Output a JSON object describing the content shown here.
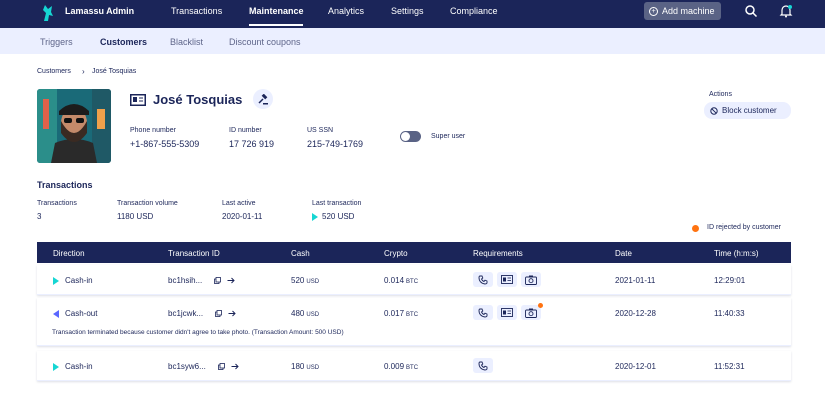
{
  "app": {
    "brand": "Lamassu Admin"
  },
  "nav": {
    "items": [
      {
        "label": "Transactions"
      },
      {
        "label": "Maintenance"
      },
      {
        "label": "Analytics"
      },
      {
        "label": "Settings"
      },
      {
        "label": "Compliance"
      }
    ],
    "active": "Maintenance",
    "add_machine_label": "Add machine"
  },
  "subnav": {
    "items": [
      {
        "label": "Triggers"
      },
      {
        "label": "Customers"
      },
      {
        "label": "Blacklist"
      },
      {
        "label": "Discount coupons"
      }
    ],
    "active": "Customers"
  },
  "breadcrumb": {
    "parent": "Customers",
    "current": "José Tosquias"
  },
  "customer": {
    "name": "José Tosquias",
    "phone_label": "Phone number",
    "phone": "+1-867-555-5309",
    "id_label": "ID number",
    "id_number": "17 726 919",
    "ssn_label": "US SSN",
    "ssn": "215-749-1769",
    "super_user_label": "Super user",
    "super_user_on": false
  },
  "actions": {
    "label": "Actions",
    "block_label": "Block customer"
  },
  "stats": {
    "section_title": "Transactions",
    "transactions_label": "Transactions",
    "transactions_value": "3",
    "volume_label": "Transaction volume",
    "volume_value": "1180 USD",
    "last_active_label": "Last active",
    "last_active_value": "2020-01-11",
    "last_tx_label": "Last transaction",
    "last_tx_value": "520 USD"
  },
  "legend": {
    "text": "ID rejected by customer",
    "color": "#ff7311"
  },
  "table": {
    "headers": [
      "Direction",
      "Transaction ID",
      "Cash",
      "Crypto",
      "Requirements",
      "Date",
      "Time (h:m:s)"
    ],
    "rows": [
      {
        "direction": "Cash-in",
        "tx_id": "bc1hsih...",
        "cash": "520",
        "cash_unit": "USD",
        "crypto": "0.014",
        "crypto_unit": "BTC",
        "requirements": [
          "phone-icon",
          "id-card-icon",
          "camera-icon"
        ],
        "date": "2021-01-11",
        "time": "12:29:01"
      },
      {
        "direction": "Cash-out",
        "tx_id": "bc1jcwk...",
        "cash": "480",
        "cash_unit": "USD",
        "crypto": "0.017",
        "crypto_unit": "BTC",
        "requirements": [
          "phone-icon",
          "id-card-icon",
          "camera-icon"
        ],
        "date": "2020-12-28",
        "time": "11:40:33",
        "note": "Transaction terminated because customer didn't agree to take photo. (Transaction Amount: 500 USD)"
      },
      {
        "direction": "Cash-in",
        "tx_id": "bc1syw6...",
        "cash": "180",
        "cash_unit": "USD",
        "crypto": "0.009",
        "crypto_unit": "BTC",
        "requirements": [
          "phone-icon"
        ],
        "date": "2020-12-01",
        "time": "11:52:31"
      }
    ]
  },
  "colors": {
    "navy": "#1b2559",
    "accent_light": "#ebefff",
    "cash_in": "#16d6d3",
    "cash_out": "#5a67ff",
    "alert": "#ff7311"
  }
}
